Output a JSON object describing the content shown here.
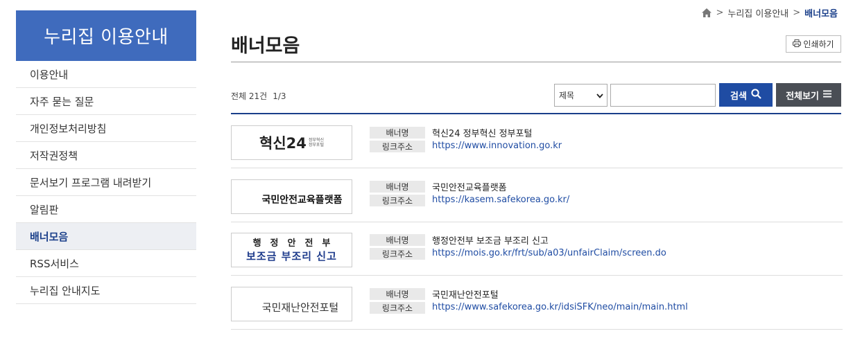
{
  "sidebar": {
    "title": "누리집 이용안내",
    "items": [
      {
        "label": "이용안내"
      },
      {
        "label": "자주 묻는 질문"
      },
      {
        "label": "개인정보처리방침"
      },
      {
        "label": "저작권정책"
      },
      {
        "label": "문서보기 프로그램 내려받기"
      },
      {
        "label": "알림판"
      },
      {
        "label": "배너모음"
      },
      {
        "label": "RSS서비스"
      },
      {
        "label": "누리집 안내지도"
      }
    ],
    "active_index": 6
  },
  "breadcrumb": {
    "home_icon": "home-icon",
    "items": [
      "누리집 이용안내",
      "배너모음"
    ],
    "separator": ">"
  },
  "header": {
    "title": "배너모음",
    "print_label": "인쇄하기"
  },
  "list_info": {
    "total": "전체 21건",
    "page": "1/3"
  },
  "search": {
    "select_value": "제목",
    "input_value": "",
    "button_label": "검색",
    "view_all_label": "전체보기"
  },
  "labels": {
    "banner_name": "배너명",
    "link_address": "링크주소"
  },
  "banners": [
    {
      "name": "혁신24 정부혁신 정부포털",
      "url": "https://www.innovation.go.kr",
      "logo": {
        "big": "혁신24",
        "small1": "정부혁신",
        "small2": "정부포털"
      }
    },
    {
      "name": "국민안전교육플랫폼",
      "url": "https://kasem.safekorea.go.kr/",
      "logo": {
        "text": "국민안전교육플랫폼"
      }
    },
    {
      "name": "행정안전부 보조금 부조리 신고",
      "url": "https://mois.go.kr/frt/sub/a03/unfairClaim/screen.do",
      "logo": {
        "top": "행정안전부",
        "bottom": "보조금 부조리 신고"
      }
    },
    {
      "name": "국민재난안전포털",
      "url": "https://www.safekorea.go.kr/idsiSFK/neo/main/main.html",
      "logo": {
        "text": "국민재난안전포털"
      }
    }
  ],
  "colors": {
    "brand": "#3f6bbd",
    "accent": "#1a3f8a",
    "search_button": "#1f4ca3",
    "view_all_button": "#4a4e55"
  }
}
